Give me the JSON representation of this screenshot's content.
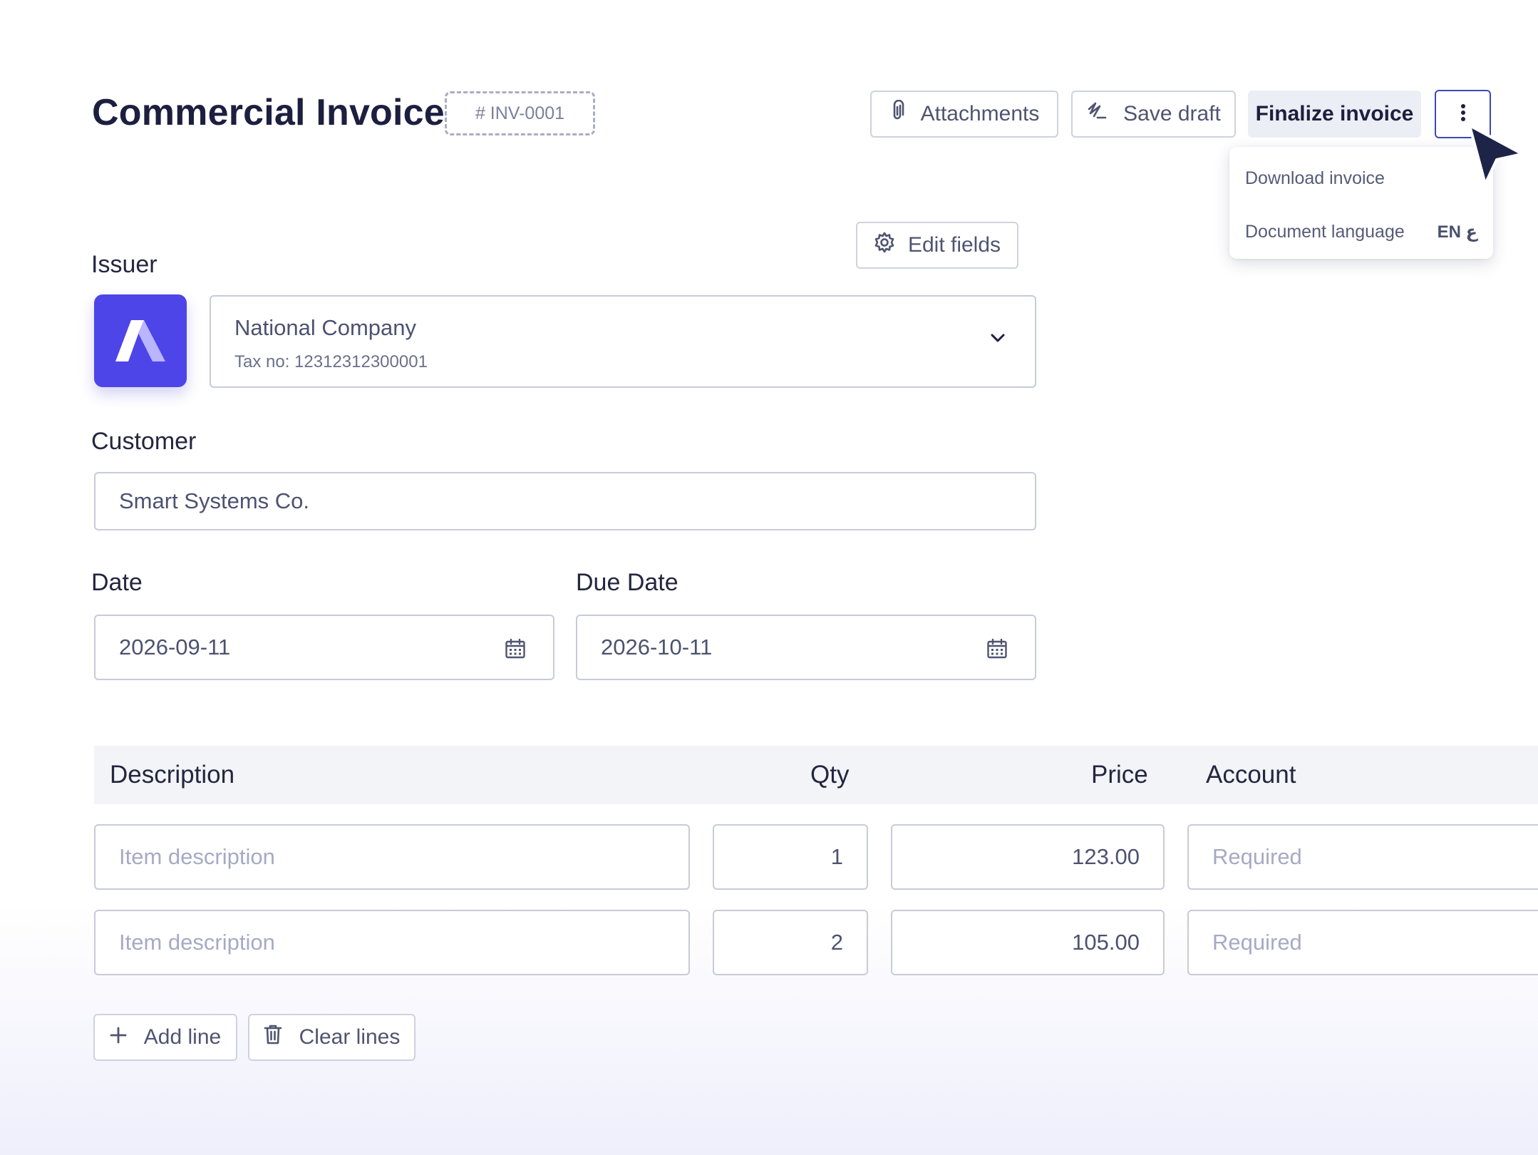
{
  "header": {
    "title": "Commercial Invoice",
    "invoice_number": "# INV-0001",
    "attachments_label": "Attachments",
    "save_draft_label": "Save draft",
    "finalize_label": "Finalize invoice"
  },
  "more_menu": {
    "items": [
      {
        "label": "Download invoice"
      },
      {
        "label": "Document language",
        "value": "EN ع"
      }
    ]
  },
  "form": {
    "edit_fields_label": "Edit fields",
    "issuer_label": "Issuer",
    "issuer": {
      "name": "National Company",
      "tax": "Tax no: 12312312300001"
    },
    "customer_label": "Customer",
    "customer_value": "Smart Systems Co.",
    "date_label": "Date",
    "date_value": "2026-09-11",
    "due_date_label": "Due Date",
    "due_date_value": "2026-10-11"
  },
  "table": {
    "columns": [
      "Description",
      "Qty",
      "Price",
      "Account"
    ],
    "rows": [
      {
        "description_placeholder": "Item description",
        "qty": "1",
        "price": "123.00",
        "account_placeholder": "Required"
      },
      {
        "description_placeholder": "Item description",
        "qty": "2",
        "price": "105.00",
        "account_placeholder": "Required"
      }
    ]
  },
  "actions": {
    "add_line_label": "Add line",
    "clear_lines_label": "Clear lines"
  },
  "colors": {
    "accent": "#4d45e8",
    "focus_border": "#3f47b8",
    "text_dark": "#1c1f3f",
    "placeholder": "#a6aac5"
  },
  "icons": [
    "paperclip-icon",
    "signature-icon",
    "more-vertical-icon",
    "cursor-arrow-icon",
    "gear-icon",
    "chevron-down-icon",
    "calendar-icon",
    "plus-icon",
    "trash-icon",
    "company-logo"
  ]
}
